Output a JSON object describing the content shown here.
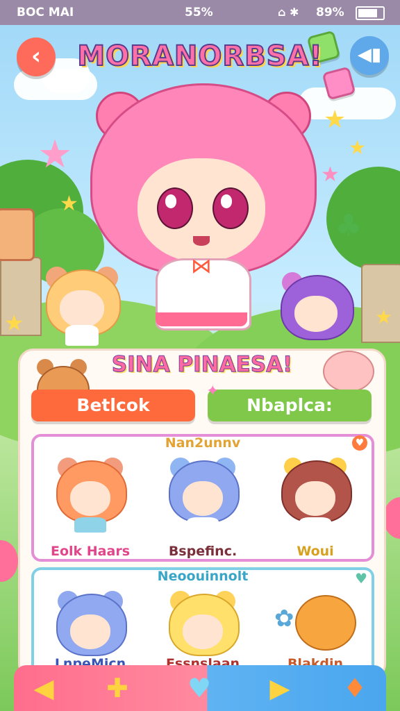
{
  "status_bar": {
    "left_text": "BOC MAI",
    "center_text": "55%",
    "right_text": "89%"
  },
  "header": {
    "title": "MORANORBSA!",
    "back_icon": "chevron-left-icon",
    "sound_icon": "speaker-icon"
  },
  "panel": {
    "subtitle": "SINA PINAESA!",
    "left_button_label": "Betlcok",
    "right_button_label": "Nbaplca:",
    "sections": [
      {
        "title": "Nan2unnv",
        "characters": [
          {
            "name": "Eolk Haars"
          },
          {
            "name": "Bspefinc."
          },
          {
            "name": "Woui"
          }
        ]
      },
      {
        "title": "Neoouinnolt",
        "characters": [
          {
            "name": "LnpeMicn"
          },
          {
            "name": "Essnslaan"
          },
          {
            "name": "Blakdin"
          }
        ]
      }
    ]
  },
  "bottom_nav": {
    "items": [
      "arrow-left-icon",
      "puzzle-piece-icon",
      "heart-icon",
      "play-icon",
      "carrot-icon"
    ]
  },
  "colors": {
    "accent_pink": "#ff6d8d",
    "accent_blue": "#4aa6ee",
    "button_orange": "#ff6a3d",
    "button_green": "#7fc84a"
  }
}
